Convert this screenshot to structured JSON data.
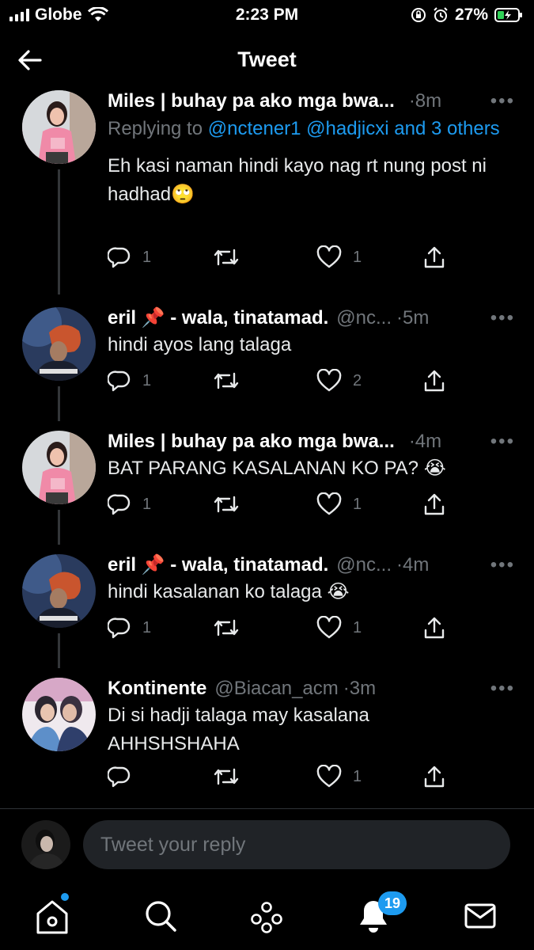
{
  "status_bar": {
    "carrier": "Globe",
    "time": "2:23 PM",
    "battery": "27%"
  },
  "header": {
    "title": "Tweet"
  },
  "tweets": [
    {
      "name": "Miles | buhay pa ako mga bwa...",
      "handle": "",
      "time": "·8m",
      "reply_prefix": "Replying to ",
      "reply_mentions": "@nctener1 @hadjicxi and 3 others",
      "text": "Eh kasi naman hindi kayo nag rt nung post ni hadhad🙄",
      "replies": "1",
      "retweets": "",
      "likes": "1"
    },
    {
      "name": "eril 📌 - wala, tinatamad.",
      "handle": "@nc...",
      "time": "·5m",
      "text": "hindi ayos lang talaga",
      "replies": "1",
      "retweets": "",
      "likes": "2"
    },
    {
      "name": "Miles | buhay pa ako mga bwa...",
      "handle": "",
      "time": "·4m",
      "text": "BAT PARANG KASALANAN KO PA? 😭",
      "replies": "1",
      "retweets": "",
      "likes": "1"
    },
    {
      "name": "eril 📌 - wala, tinatamad.",
      "handle": "@nc...",
      "time": "·4m",
      "text": "hindi kasalanan ko talaga 😭",
      "replies": "1",
      "retweets": "",
      "likes": "1"
    },
    {
      "name": "Kontinente",
      "handle": "@Biacan_acm",
      "time": "·3m",
      "text": "Di si hadji talaga may kasalana AHHSHSHAHA",
      "replies": "",
      "retweets": "",
      "likes": "1"
    }
  ],
  "composer": {
    "placeholder": "Tweet your reply"
  },
  "bottom_nav": {
    "notifications_badge": "19"
  },
  "colors": {
    "background": "#000000",
    "accent": "#1d9bf0",
    "muted": "#71767b"
  },
  "icons": [
    "back-arrow-icon",
    "reply-icon",
    "retweet-icon",
    "like-icon",
    "share-icon",
    "more-icon",
    "home-icon",
    "search-icon",
    "spaces-icon",
    "notifications-icon",
    "messages-icon"
  ]
}
